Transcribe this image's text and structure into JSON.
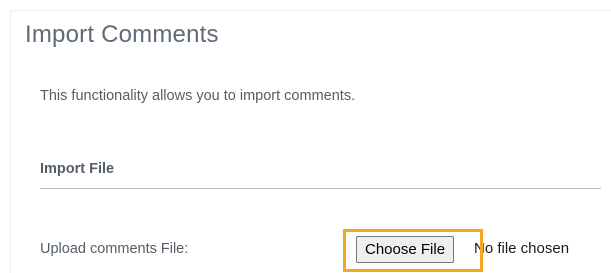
{
  "page": {
    "title": "Import Comments",
    "description": "This functionality allows you to import comments."
  },
  "import_section": {
    "heading": "Import File",
    "upload_label": "Upload comments File:",
    "choose_button_label": "Choose File",
    "file_status": "No file chosen"
  },
  "colors": {
    "highlight": "#f5a623",
    "text": "#555e68",
    "title": "#5f6b77"
  }
}
